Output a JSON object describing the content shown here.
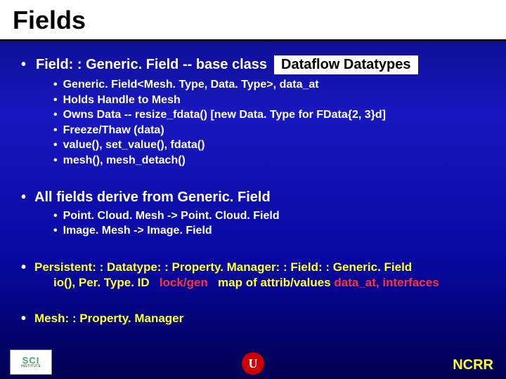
{
  "title": "Fields",
  "tag": "Dataflow Datatypes",
  "sec1": {
    "heading": "Field: : Generic. Field -- base class",
    "items": [
      "Generic. Field<Mesh. Type, Data. Type>, data_at",
      "Holds Handle to Mesh",
      "Owns Data -- resize_fdata() [new Data. Type for FData{2, 3}d]",
      "Freeze/Thaw (data)",
      "value(), set_value(), fdata()",
      "mesh(), mesh_detach()"
    ]
  },
  "sec2": {
    "heading": "All fields derive from Generic. Field",
    "items": [
      "Point. Cloud. Mesh -> Point. Cloud. Field",
      "Image. Mesh -> Image. Field"
    ]
  },
  "sec3": {
    "line_pre": "Persistent: : Datatype: : Property. Manager: : Field: : Generic. Field",
    "seg_a": "io(), Per. Type. ID",
    "seg_b": "lock/gen",
    "seg_c": "map of attrib/values",
    "seg_d": "data_at, interfaces"
  },
  "sec4": {
    "heading": "Mesh: : Property. Manager"
  },
  "footer": "NCRR",
  "logos": {
    "sci_top": "SCI",
    "sci_bottom": "INSTITUTE",
    "u": "U"
  }
}
